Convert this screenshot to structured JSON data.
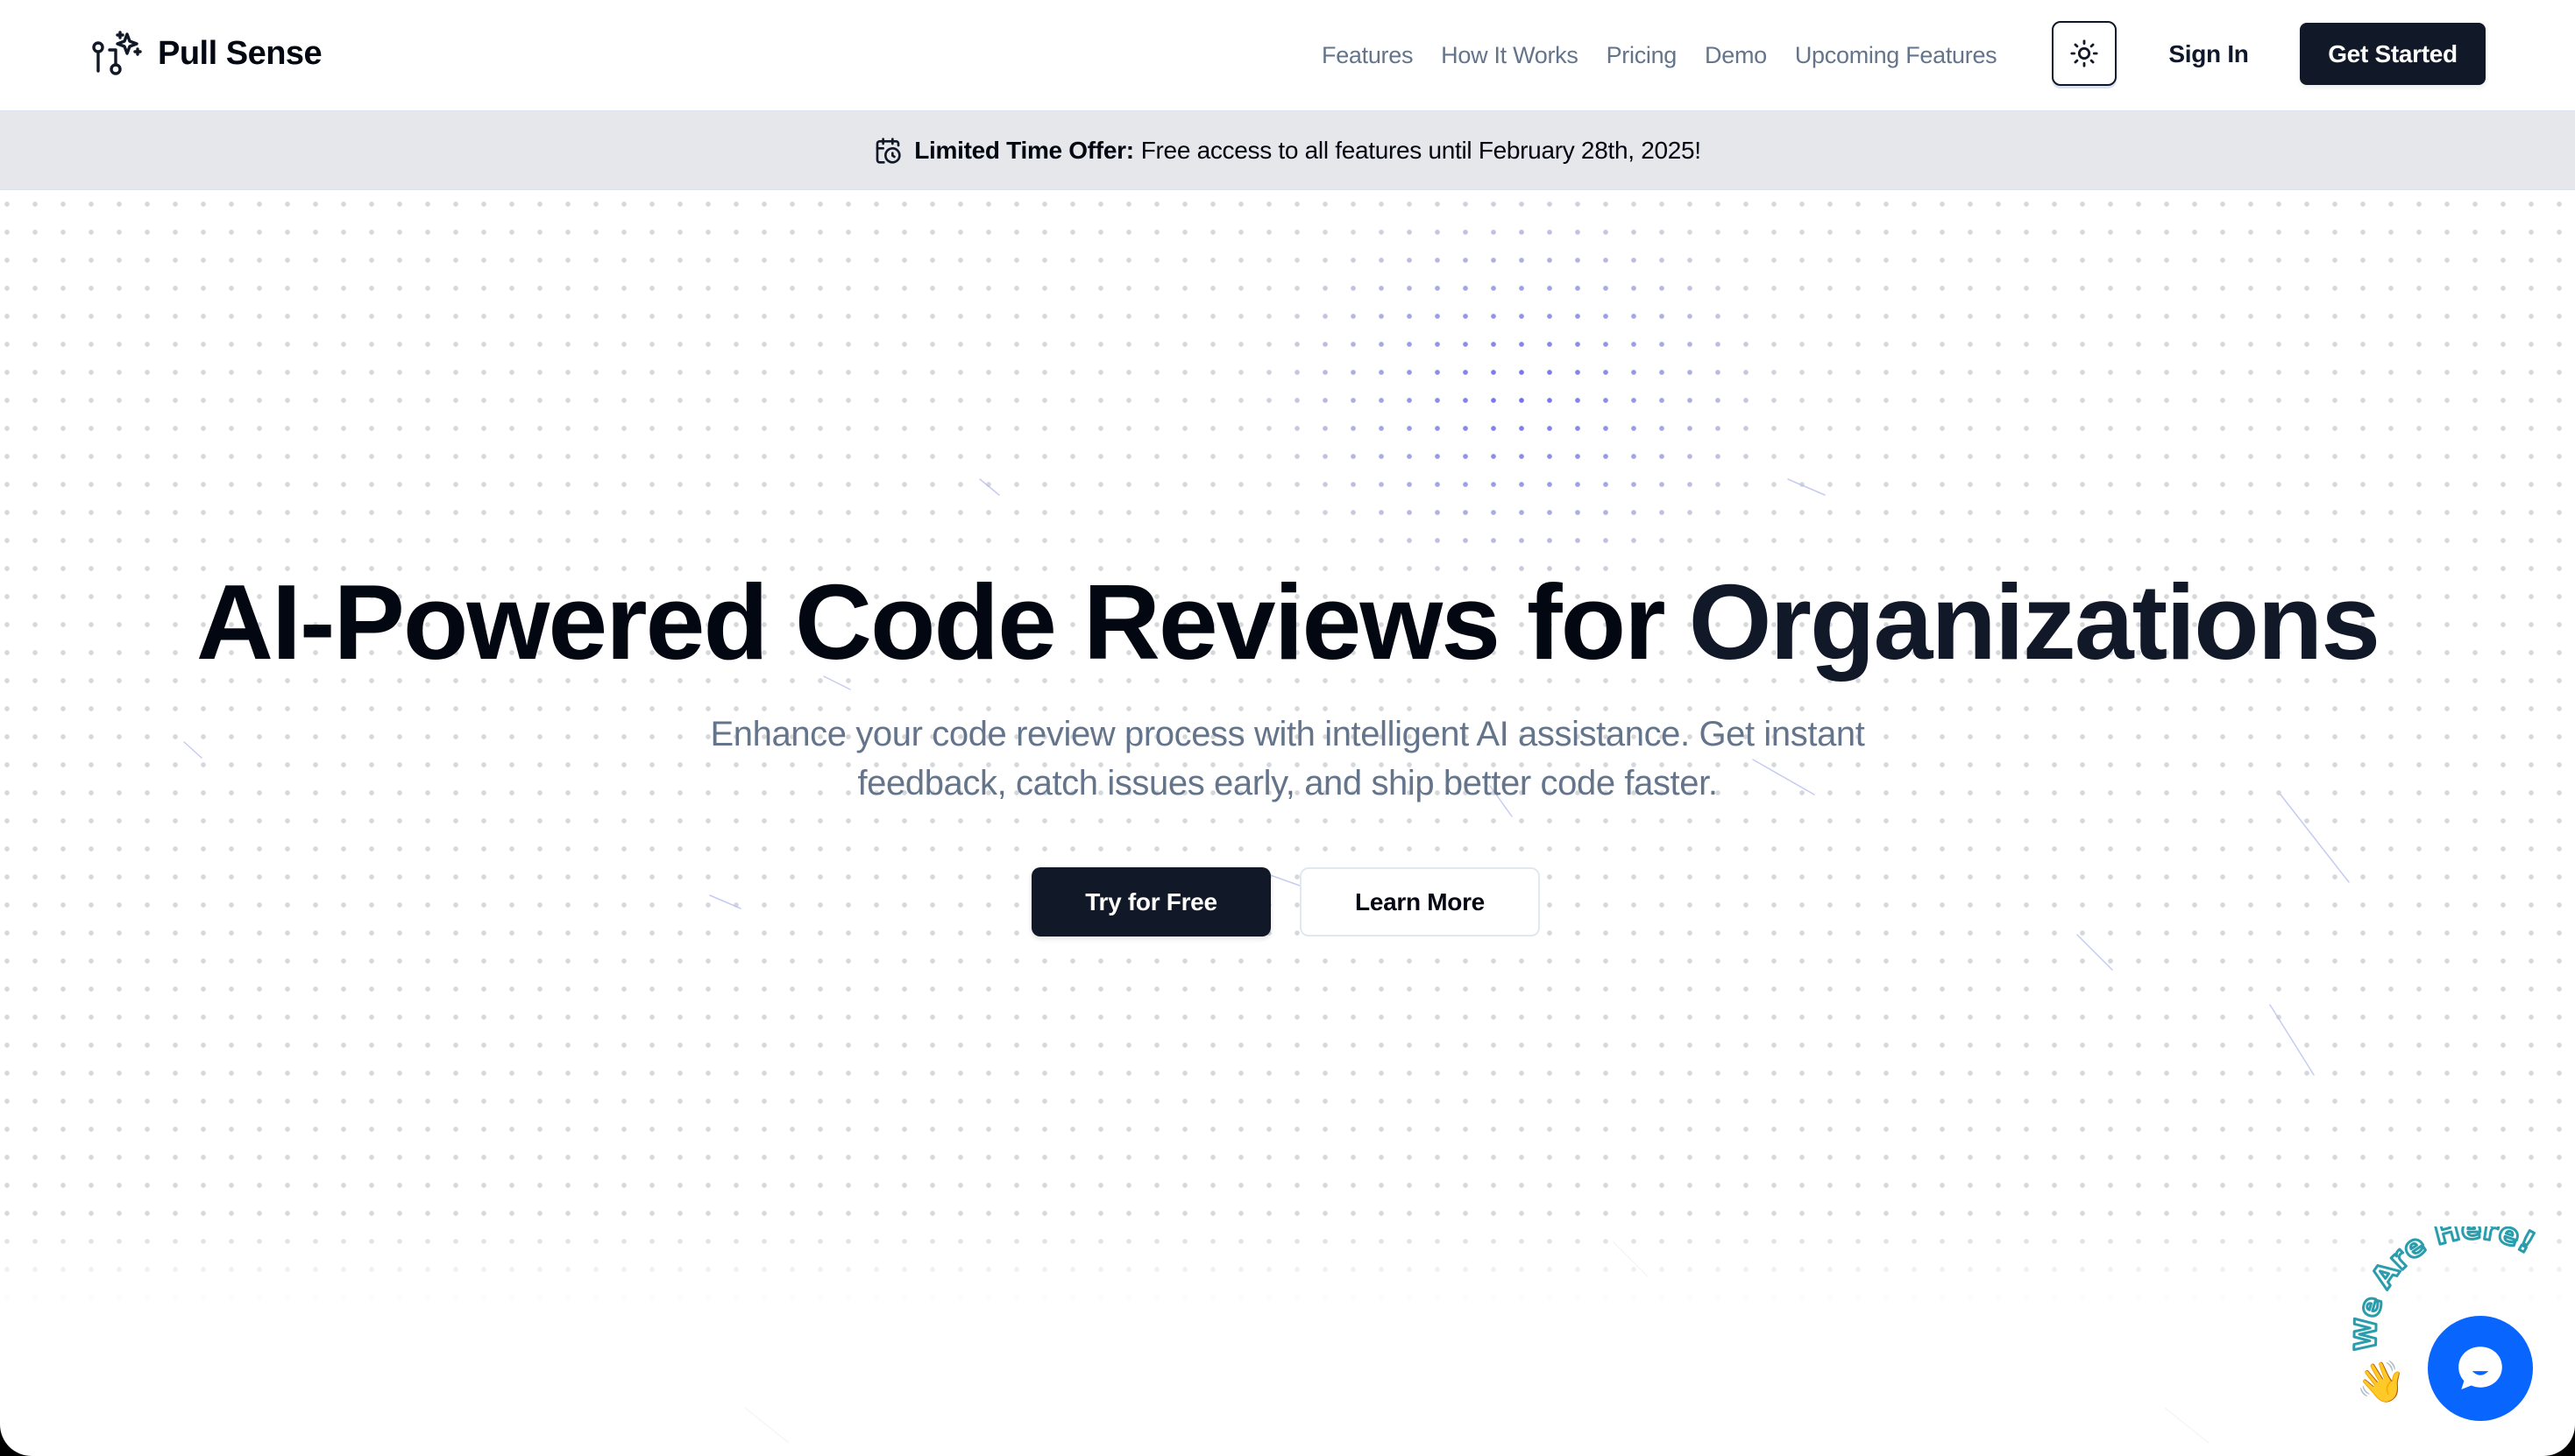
{
  "header": {
    "brand": "Pull Sense",
    "logo_icon": "git-pull-request-sparkle-icon",
    "nav": [
      {
        "label": "Features"
      },
      {
        "label": "How It Works"
      },
      {
        "label": "Pricing"
      },
      {
        "label": "Demo"
      },
      {
        "label": "Upcoming Features"
      }
    ],
    "theme_toggle_icon": "sun-icon",
    "sign_in_label": "Sign In",
    "get_started_label": "Get Started"
  },
  "banner": {
    "icon": "calendar-clock-icon",
    "strong": "Limited Time Offer:",
    "text": "Free access to all features until February 28th, 2025!"
  },
  "hero": {
    "headline": "AI-Powered Code Reviews for",
    "headline_accent": "Organizations",
    "subtitle": "Enhance your code review process with intelligent AI assistance. Get instant feedback, catch issues early, and ship better code faster.",
    "primary_cta": "Try for Free",
    "secondary_cta": "Learn More"
  },
  "chat_widget": {
    "label": "We Are Here!",
    "wave_emoji": "👋",
    "icon": "chat-bubble-icon"
  },
  "colors": {
    "brand_dark": "#111827",
    "text_muted": "#64748b",
    "banner_bg": "#e5e7eb",
    "dot_accent": "#6f6ff0",
    "chat_blue": "#0866ff",
    "chat_label_teal": "#2a9dad"
  }
}
